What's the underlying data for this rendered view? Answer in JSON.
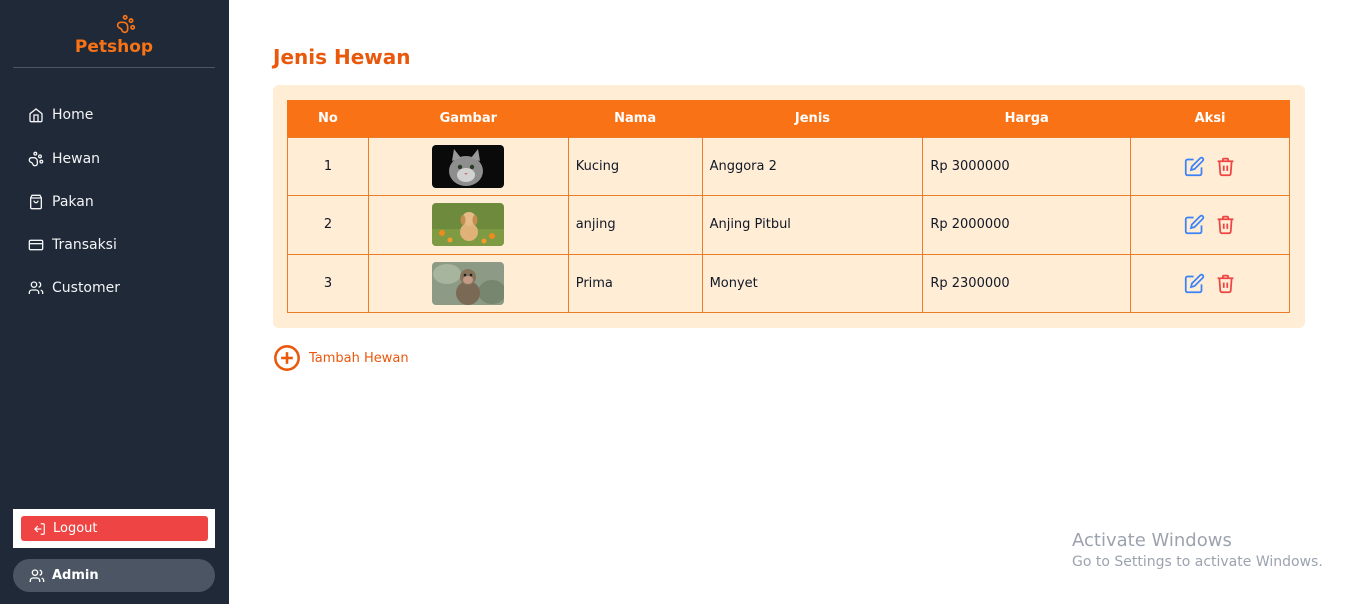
{
  "brand": {
    "name": "Petshop",
    "icon": "paw-icon",
    "color": "#f97316"
  },
  "nav": [
    {
      "label": "Home",
      "icon": "home-icon"
    },
    {
      "label": "Hewan",
      "icon": "paw-icon"
    },
    {
      "label": "Pakan",
      "icon": "shopping-bag-icon"
    },
    {
      "label": "Transaksi",
      "icon": "credit-card-icon"
    },
    {
      "label": "Customer",
      "icon": "users-icon"
    }
  ],
  "logout_label": "Logout",
  "user": {
    "label": "Admin",
    "icon": "users-icon"
  },
  "page": {
    "title": "Jenis Hewan"
  },
  "table": {
    "headers": [
      "No",
      "Gambar",
      "Nama",
      "Jenis",
      "Harga",
      "Aksi"
    ],
    "rows": [
      {
        "no": "1",
        "image": "cat-photo",
        "nama": "Kucing",
        "jenis": "Anggora 2",
        "harga": "Rp 3000000"
      },
      {
        "no": "2",
        "image": "puppy-photo",
        "nama": "anjing",
        "jenis": "Anjing Pitbul",
        "harga": "Rp 2000000"
      },
      {
        "no": "3",
        "image": "monkey-photo",
        "nama": "Prima",
        "jenis": "Monyet",
        "harga": "Rp 2300000"
      }
    ]
  },
  "add_button": {
    "label": "Tambah Hewan",
    "icon": "plus-circle-icon"
  },
  "watermark": {
    "line1": "Activate Windows",
    "line2": "Go to Settings to activate Windows."
  },
  "colors": {
    "sidebar": "#1f2937",
    "accent": "#f97316",
    "danger": "#ef4444",
    "edit": "#3b82f6",
    "card": "#ffedd5"
  }
}
